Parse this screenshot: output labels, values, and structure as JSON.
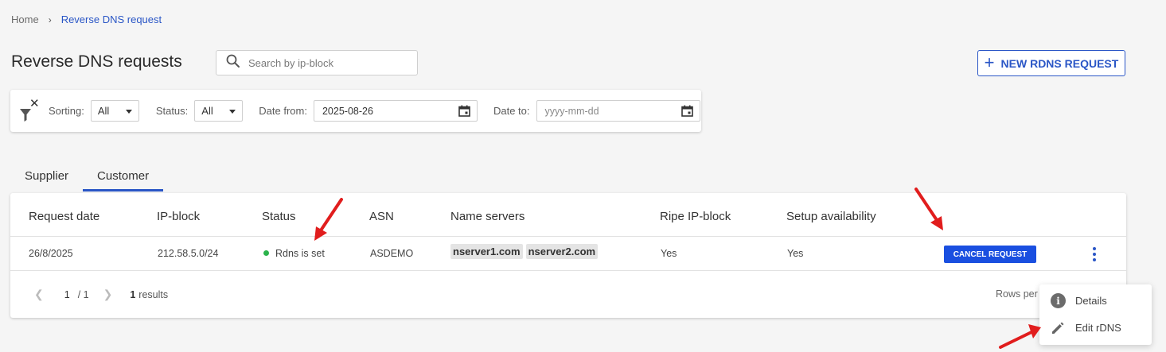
{
  "breadcrumb": {
    "home": "Home",
    "separator": "›",
    "current": "Reverse DNS request"
  },
  "page": {
    "title": "Reverse DNS requests"
  },
  "search": {
    "placeholder": "Search by ip-block",
    "value": ""
  },
  "new_button": {
    "label": "NEW RDNS REQUEST"
  },
  "filters": {
    "sorting": {
      "label": "Sorting:",
      "value": "All"
    },
    "status": {
      "label": "Status:",
      "value": "All"
    },
    "date_from": {
      "label": "Date from:",
      "value": "2025-08-26"
    },
    "date_to": {
      "label": "Date to:",
      "value": "",
      "placeholder": "yyyy-mm-dd"
    }
  },
  "tabs": [
    {
      "label": "Supplier",
      "active": false
    },
    {
      "label": "Customer",
      "active": true
    }
  ],
  "table": {
    "columns": [
      "Request date",
      "IP-block",
      "Status",
      "ASN",
      "Name servers",
      "Ripe IP-block",
      "Setup availability"
    ],
    "rows": [
      {
        "request_date": "26/8/2025",
        "ip_block": "212.58.5.0/24",
        "status": "Rdns is set",
        "asn": "ASDEMO",
        "name_servers": [
          "nserver1.com",
          "nserver2.com"
        ],
        "ripe_ip_block": "Yes",
        "setup_availability": "Yes",
        "action": "CANCEL REQUEST"
      }
    ]
  },
  "pagination": {
    "current": "1",
    "total": "/ 1",
    "results_count": "1",
    "results_label": "results",
    "rows_per_page_label": "Rows per"
  },
  "row_menu": {
    "items": [
      {
        "label": "Details",
        "icon": "info-icon"
      },
      {
        "label": "Edit rDNS",
        "icon": "pencil-icon"
      }
    ]
  },
  "colors": {
    "accent": "#2a56c6",
    "cancel_button": "#1a4fe0",
    "status_ok": "#2bb34b",
    "annotation_arrow": "#e11d1d"
  }
}
